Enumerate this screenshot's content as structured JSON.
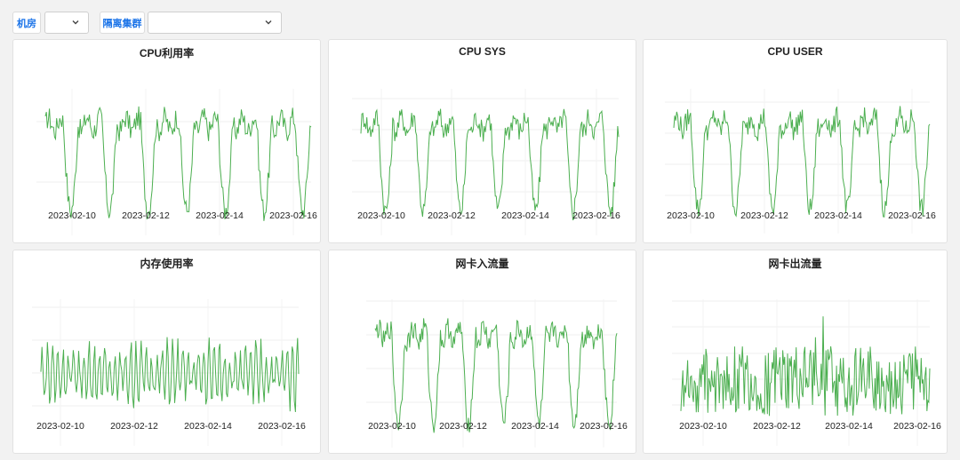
{
  "filters": {
    "room_label": "机房",
    "room_value": "",
    "cluster_label": "隔离集群",
    "cluster_value": ""
  },
  "panels": [
    {
      "title": "CPU利用率",
      "x_ticks": [
        "2023-02-10",
        "2023-02-12",
        "2023-02-14",
        "2023-02-16"
      ]
    },
    {
      "title": "CPU SYS",
      "x_ticks": [
        "2023-02-10",
        "2023-02-12",
        "2023-02-14",
        "2023-02-16"
      ]
    },
    {
      "title": "CPU USER",
      "x_ticks": [
        "2023-02-10",
        "2023-02-12",
        "2023-02-14",
        "2023-02-16"
      ]
    },
    {
      "title": "内存使用率",
      "x_ticks": [
        "2023-02-10",
        "2023-02-12",
        "2023-02-14",
        "2023-02-16"
      ]
    },
    {
      "title": "网卡入流量",
      "x_ticks": [
        "2023-02-10",
        "2023-02-12",
        "2023-02-14",
        "2023-02-16"
      ]
    },
    {
      "title": "网卡出流量",
      "x_ticks": [
        "2023-02-10",
        "2023-02-12",
        "2023-02-14",
        "2023-02-16"
      ]
    }
  ],
  "chart_data": [
    {
      "type": "line",
      "title": "CPU利用率",
      "x_range": [
        "2023-02-09",
        "2023-02-16"
      ],
      "grid": true,
      "line_color": "#4caf50",
      "pattern": "daily-cycle"
    },
    {
      "type": "line",
      "title": "CPU SYS",
      "x_range": [
        "2023-02-09",
        "2023-02-16"
      ],
      "grid": true,
      "line_color": "#4caf50",
      "pattern": "daily-cycle"
    },
    {
      "type": "line",
      "title": "CPU USER",
      "x_range": [
        "2023-02-09",
        "2023-02-16"
      ],
      "grid": true,
      "line_color": "#4caf50",
      "pattern": "daily-cycle"
    },
    {
      "type": "line",
      "title": "内存使用率",
      "x_range": [
        "2023-02-09",
        "2023-02-16"
      ],
      "grid": true,
      "line_color": "#4caf50",
      "pattern": "high-frequency"
    },
    {
      "type": "line",
      "title": "网卡入流量",
      "x_range": [
        "2023-02-09",
        "2023-02-16"
      ],
      "grid": true,
      "line_color": "#4caf50",
      "pattern": "daily-cycle"
    },
    {
      "type": "line",
      "title": "网卡出流量",
      "x_range": [
        "2023-02-09",
        "2023-02-16"
      ],
      "grid": true,
      "line_color": "#4caf50",
      "pattern": "noisy"
    }
  ]
}
